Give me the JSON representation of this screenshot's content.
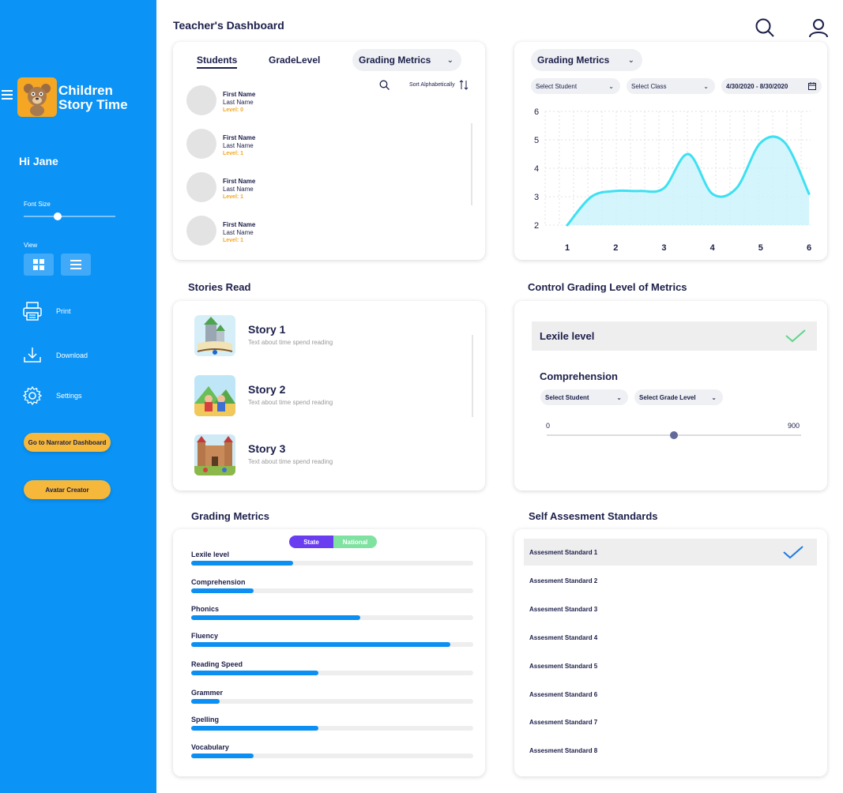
{
  "sidebar": {
    "brand_line1": "Children",
    "brand_line2": "Story Time",
    "greeting": "Hi Jane",
    "font_size_label": "Font Size",
    "font_size_level": 0.37,
    "view_label": "View",
    "print_label": "Print",
    "download_label": "Download",
    "settings_label": "Settings",
    "narrator_button": "Go to Narrator Dashboard",
    "avatar_button": "Avatar Creator"
  },
  "header": {
    "title": "Teacher's Dashboard"
  },
  "students_card": {
    "tabs": [
      "Students",
      "GradeLevel"
    ],
    "metrics_dropdown": "Grading Metrics",
    "sort_label": "Sort Alphabetically",
    "students": [
      {
        "first": "First Name",
        "last": "Last Name",
        "level": "Level: 0"
      },
      {
        "first": "First Name",
        "last": "Last Name",
        "level": "Level: 1"
      },
      {
        "first": "First Name",
        "last": "Last Name",
        "level": "Level: 1"
      },
      {
        "first": "First Name",
        "last": "Last Name",
        "level": "Level: 1"
      }
    ]
  },
  "chart_card": {
    "metrics_dropdown": "Grading Metrics",
    "select_student": "Select Student",
    "select_class": "Select Class",
    "date_range": "4/30/2020 - 8/30/2020"
  },
  "chart_data": {
    "type": "area",
    "x": [
      1,
      1.5,
      2,
      2.5,
      3,
      3.5,
      4,
      4.5,
      5,
      5.5,
      6
    ],
    "y": [
      2.0,
      3.0,
      3.2,
      3.2,
      3.3,
      4.5,
      3.1,
      3.3,
      4.9,
      4.9,
      3.1
    ],
    "xticks": [
      "1",
      "2",
      "3",
      "4",
      "5",
      "6"
    ],
    "yticks": [
      "2",
      "3",
      "4",
      "5",
      "6"
    ],
    "xlim": [
      1,
      6
    ],
    "ylim": [
      2,
      6
    ],
    "grid": true,
    "line_color": "#3ee0f2",
    "fill_color": "#c9f3fb"
  },
  "stories_section": {
    "title": "Stories Read",
    "stories": [
      {
        "title": "Story 1",
        "desc": "Text about time spend reading"
      },
      {
        "title": "Story 2",
        "desc": "Text about time spend reading"
      },
      {
        "title": "Story 3",
        "desc": "Text about time spend reading"
      }
    ]
  },
  "control_section": {
    "title": "Control Grading Level of Metrics",
    "lexile_label": "Lexile level",
    "comprehension_label": "Comprehension",
    "select_student": "Select Student",
    "select_grade_level": "Select Grade Level",
    "range_min": "0",
    "range_max": "900",
    "range_value": 0.5
  },
  "grading_section": {
    "title": "Grading Metrics",
    "toggle_state": "State",
    "toggle_national": "National",
    "metrics": [
      {
        "label": "Lexile level",
        "value": 0.36
      },
      {
        "label": "Comprehension",
        "value": 0.22
      },
      {
        "label": "Phonics",
        "value": 0.6
      },
      {
        "label": "Fluency",
        "value": 0.92
      },
      {
        "label": "Reading Speed",
        "value": 0.45
      },
      {
        "label": "Grammer",
        "value": 0.1
      },
      {
        "label": "Spelling",
        "value": 0.45
      },
      {
        "label": "Vocabulary",
        "value": 0.22
      }
    ]
  },
  "assessment_section": {
    "title": "Self Assesment Standards",
    "standards": [
      "Assesment Standard 1",
      "Assesment Standard 2",
      "Assesment Standard 3",
      "Assesment Standard 4",
      "Assesment Standard 5",
      "Assesment Standard 6",
      "Assesment Standard 7",
      "Assesment Standard 8"
    ]
  },
  "colors": {
    "sidebar": "#0b93f6",
    "accent_orange": "#f5a623",
    "button_yellow": "#f6b83a",
    "toggle_state": "#6a3df0",
    "toggle_national": "#7fe2a0",
    "bar": "#0b8ff2",
    "check_green": "#5fd68a",
    "check_blue": "#1f7ae0"
  }
}
